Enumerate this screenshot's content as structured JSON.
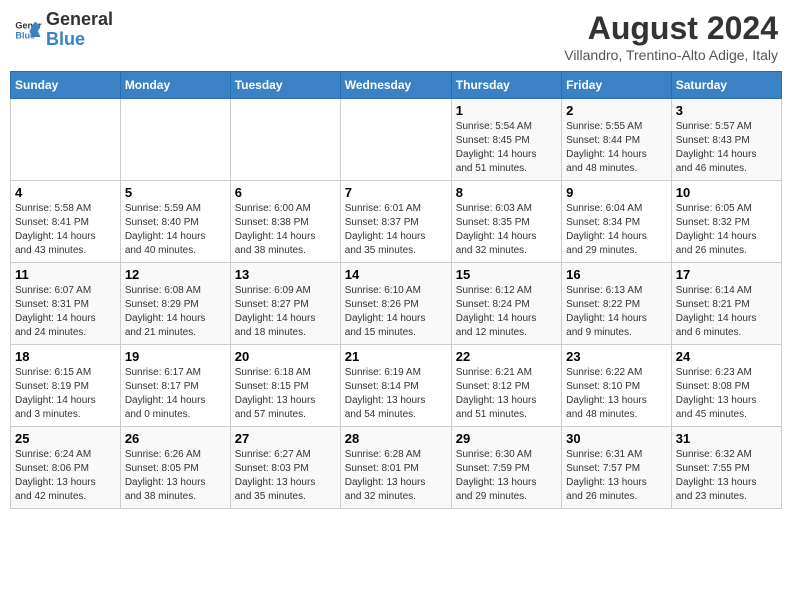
{
  "header": {
    "logo_line1": "General",
    "logo_line2": "Blue",
    "month_year": "August 2024",
    "location": "Villandro, Trentino-Alto Adige, Italy"
  },
  "weekdays": [
    "Sunday",
    "Monday",
    "Tuesday",
    "Wednesday",
    "Thursday",
    "Friday",
    "Saturday"
  ],
  "weeks": [
    [
      {
        "day": "",
        "info": ""
      },
      {
        "day": "",
        "info": ""
      },
      {
        "day": "",
        "info": ""
      },
      {
        "day": "",
        "info": ""
      },
      {
        "day": "1",
        "info": "Sunrise: 5:54 AM\nSunset: 8:45 PM\nDaylight: 14 hours\nand 51 minutes."
      },
      {
        "day": "2",
        "info": "Sunrise: 5:55 AM\nSunset: 8:44 PM\nDaylight: 14 hours\nand 48 minutes."
      },
      {
        "day": "3",
        "info": "Sunrise: 5:57 AM\nSunset: 8:43 PM\nDaylight: 14 hours\nand 46 minutes."
      }
    ],
    [
      {
        "day": "4",
        "info": "Sunrise: 5:58 AM\nSunset: 8:41 PM\nDaylight: 14 hours\nand 43 minutes."
      },
      {
        "day": "5",
        "info": "Sunrise: 5:59 AM\nSunset: 8:40 PM\nDaylight: 14 hours\nand 40 minutes."
      },
      {
        "day": "6",
        "info": "Sunrise: 6:00 AM\nSunset: 8:38 PM\nDaylight: 14 hours\nand 38 minutes."
      },
      {
        "day": "7",
        "info": "Sunrise: 6:01 AM\nSunset: 8:37 PM\nDaylight: 14 hours\nand 35 minutes."
      },
      {
        "day": "8",
        "info": "Sunrise: 6:03 AM\nSunset: 8:35 PM\nDaylight: 14 hours\nand 32 minutes."
      },
      {
        "day": "9",
        "info": "Sunrise: 6:04 AM\nSunset: 8:34 PM\nDaylight: 14 hours\nand 29 minutes."
      },
      {
        "day": "10",
        "info": "Sunrise: 6:05 AM\nSunset: 8:32 PM\nDaylight: 14 hours\nand 26 minutes."
      }
    ],
    [
      {
        "day": "11",
        "info": "Sunrise: 6:07 AM\nSunset: 8:31 PM\nDaylight: 14 hours\nand 24 minutes."
      },
      {
        "day": "12",
        "info": "Sunrise: 6:08 AM\nSunset: 8:29 PM\nDaylight: 14 hours\nand 21 minutes."
      },
      {
        "day": "13",
        "info": "Sunrise: 6:09 AM\nSunset: 8:27 PM\nDaylight: 14 hours\nand 18 minutes."
      },
      {
        "day": "14",
        "info": "Sunrise: 6:10 AM\nSunset: 8:26 PM\nDaylight: 14 hours\nand 15 minutes."
      },
      {
        "day": "15",
        "info": "Sunrise: 6:12 AM\nSunset: 8:24 PM\nDaylight: 14 hours\nand 12 minutes."
      },
      {
        "day": "16",
        "info": "Sunrise: 6:13 AM\nSunset: 8:22 PM\nDaylight: 14 hours\nand 9 minutes."
      },
      {
        "day": "17",
        "info": "Sunrise: 6:14 AM\nSunset: 8:21 PM\nDaylight: 14 hours\nand 6 minutes."
      }
    ],
    [
      {
        "day": "18",
        "info": "Sunrise: 6:15 AM\nSunset: 8:19 PM\nDaylight: 14 hours\nand 3 minutes."
      },
      {
        "day": "19",
        "info": "Sunrise: 6:17 AM\nSunset: 8:17 PM\nDaylight: 14 hours\nand 0 minutes."
      },
      {
        "day": "20",
        "info": "Sunrise: 6:18 AM\nSunset: 8:15 PM\nDaylight: 13 hours\nand 57 minutes."
      },
      {
        "day": "21",
        "info": "Sunrise: 6:19 AM\nSunset: 8:14 PM\nDaylight: 13 hours\nand 54 minutes."
      },
      {
        "day": "22",
        "info": "Sunrise: 6:21 AM\nSunset: 8:12 PM\nDaylight: 13 hours\nand 51 minutes."
      },
      {
        "day": "23",
        "info": "Sunrise: 6:22 AM\nSunset: 8:10 PM\nDaylight: 13 hours\nand 48 minutes."
      },
      {
        "day": "24",
        "info": "Sunrise: 6:23 AM\nSunset: 8:08 PM\nDaylight: 13 hours\nand 45 minutes."
      }
    ],
    [
      {
        "day": "25",
        "info": "Sunrise: 6:24 AM\nSunset: 8:06 PM\nDaylight: 13 hours\nand 42 minutes."
      },
      {
        "day": "26",
        "info": "Sunrise: 6:26 AM\nSunset: 8:05 PM\nDaylight: 13 hours\nand 38 minutes."
      },
      {
        "day": "27",
        "info": "Sunrise: 6:27 AM\nSunset: 8:03 PM\nDaylight: 13 hours\nand 35 minutes."
      },
      {
        "day": "28",
        "info": "Sunrise: 6:28 AM\nSunset: 8:01 PM\nDaylight: 13 hours\nand 32 minutes."
      },
      {
        "day": "29",
        "info": "Sunrise: 6:30 AM\nSunset: 7:59 PM\nDaylight: 13 hours\nand 29 minutes."
      },
      {
        "day": "30",
        "info": "Sunrise: 6:31 AM\nSunset: 7:57 PM\nDaylight: 13 hours\nand 26 minutes."
      },
      {
        "day": "31",
        "info": "Sunrise: 6:32 AM\nSunset: 7:55 PM\nDaylight: 13 hours\nand 23 minutes."
      }
    ]
  ]
}
